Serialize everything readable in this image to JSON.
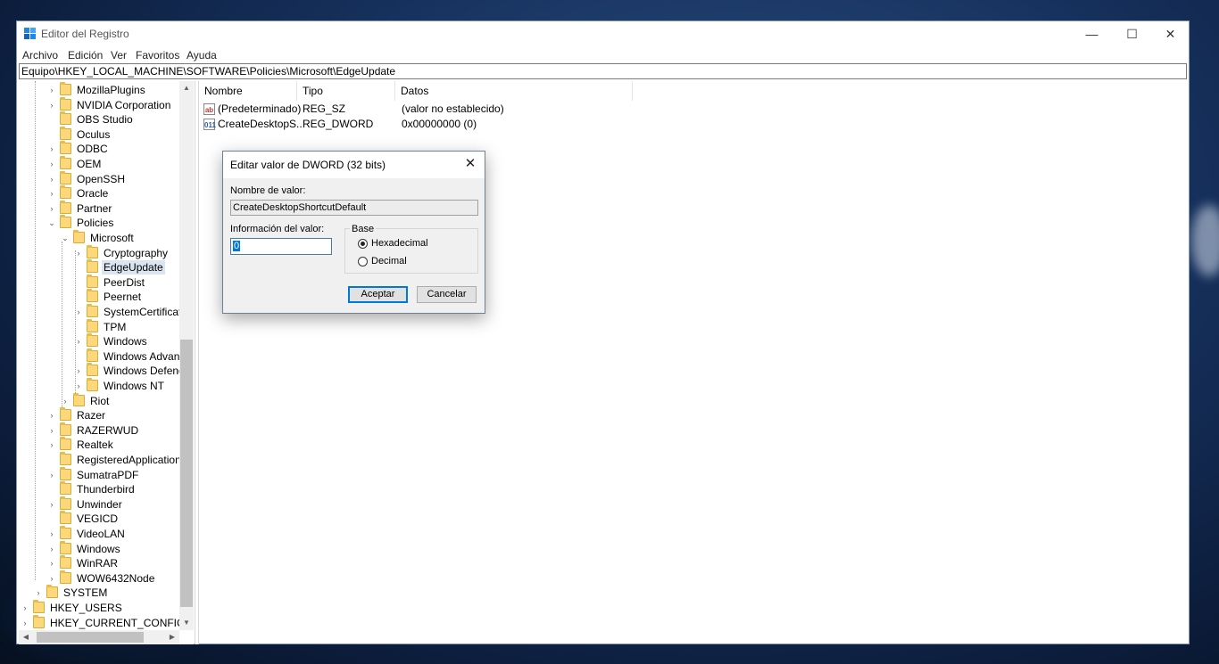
{
  "window": {
    "title": "Editor del Registro",
    "minimize": "—",
    "maximize": "☐",
    "close": "✕"
  },
  "menu": [
    "Archivo",
    "Edición",
    "Ver",
    "Favoritos",
    "Ayuda"
  ],
  "address": "Equipo\\HKEY_LOCAL_MACHINE\\SOFTWARE\\Policies\\Microsoft\\EdgeUpdate",
  "tree": [
    {
      "label": "MozillaPlugins",
      "expander": "›"
    },
    {
      "label": "NVIDIA Corporation",
      "expander": "›"
    },
    {
      "label": "OBS Studio",
      "expander": ""
    },
    {
      "label": "Oculus",
      "expander": ""
    },
    {
      "label": "ODBC",
      "expander": "›"
    },
    {
      "label": "OEM",
      "expander": "›"
    },
    {
      "label": "OpenSSH",
      "expander": "›"
    },
    {
      "label": "Oracle",
      "expander": "›"
    },
    {
      "label": "Partner",
      "expander": "›"
    },
    {
      "label": "Policies",
      "expander": "⌄"
    },
    {
      "label": "Microsoft",
      "expander": "⌄"
    },
    {
      "label": "Cryptography",
      "expander": "›"
    },
    {
      "label": "EdgeUpdate",
      "expander": "",
      "selected": true
    },
    {
      "label": "PeerDist",
      "expander": ""
    },
    {
      "label": "Peernet",
      "expander": ""
    },
    {
      "label": "SystemCertificates",
      "expander": "›"
    },
    {
      "label": "TPM",
      "expander": ""
    },
    {
      "label": "Windows",
      "expander": "›"
    },
    {
      "label": "Windows Advanced",
      "expander": ""
    },
    {
      "label": "Windows Defender",
      "expander": "›"
    },
    {
      "label": "Windows NT",
      "expander": "›"
    },
    {
      "label": "Riot",
      "expander": "›"
    },
    {
      "label": "Razer",
      "expander": "›"
    },
    {
      "label": "RAZERWUD",
      "expander": "›"
    },
    {
      "label": "Realtek",
      "expander": "›"
    },
    {
      "label": "RegisteredApplications",
      "expander": ""
    },
    {
      "label": "SumatraPDF",
      "expander": "›"
    },
    {
      "label": "Thunderbird",
      "expander": ""
    },
    {
      "label": "Unwinder",
      "expander": "›"
    },
    {
      "label": "VEGICD",
      "expander": ""
    },
    {
      "label": "VideoLAN",
      "expander": "›"
    },
    {
      "label": "Windows",
      "expander": "›"
    },
    {
      "label": "WinRAR",
      "expander": "›"
    },
    {
      "label": "WOW6432Node",
      "expander": "›"
    },
    {
      "label": "SYSTEM",
      "expander": "›"
    },
    {
      "label": "HKEY_USERS",
      "expander": "›"
    },
    {
      "label": "HKEY_CURRENT_CONFIG",
      "expander": "›"
    }
  ],
  "scroll": {
    "up": "▲",
    "down": "▼",
    "left": "◀",
    "right": "▶"
  },
  "list": {
    "headers": [
      "Nombre",
      "Tipo",
      "Datos"
    ],
    "rows": [
      {
        "icon": "ab",
        "name": "(Predeterminado)",
        "type": "REG_SZ",
        "data": "(valor no establecido)"
      },
      {
        "icon": "011",
        "name": "CreateDesktopS...",
        "type": "REG_DWORD",
        "data": "0x00000000 (0)"
      }
    ]
  },
  "dialog": {
    "title": "Editar valor de DWORD (32 bits)",
    "close": "✕",
    "name_label": "Nombre de valor:",
    "name_value": "CreateDesktopShortcutDefault",
    "data_label": "Información del valor:",
    "data_value": "0",
    "base_label": "Base",
    "hex_label": "Hexadecimal",
    "dec_label": "Decimal",
    "hex_selected": true,
    "ok": "Aceptar",
    "cancel": "Cancelar"
  }
}
